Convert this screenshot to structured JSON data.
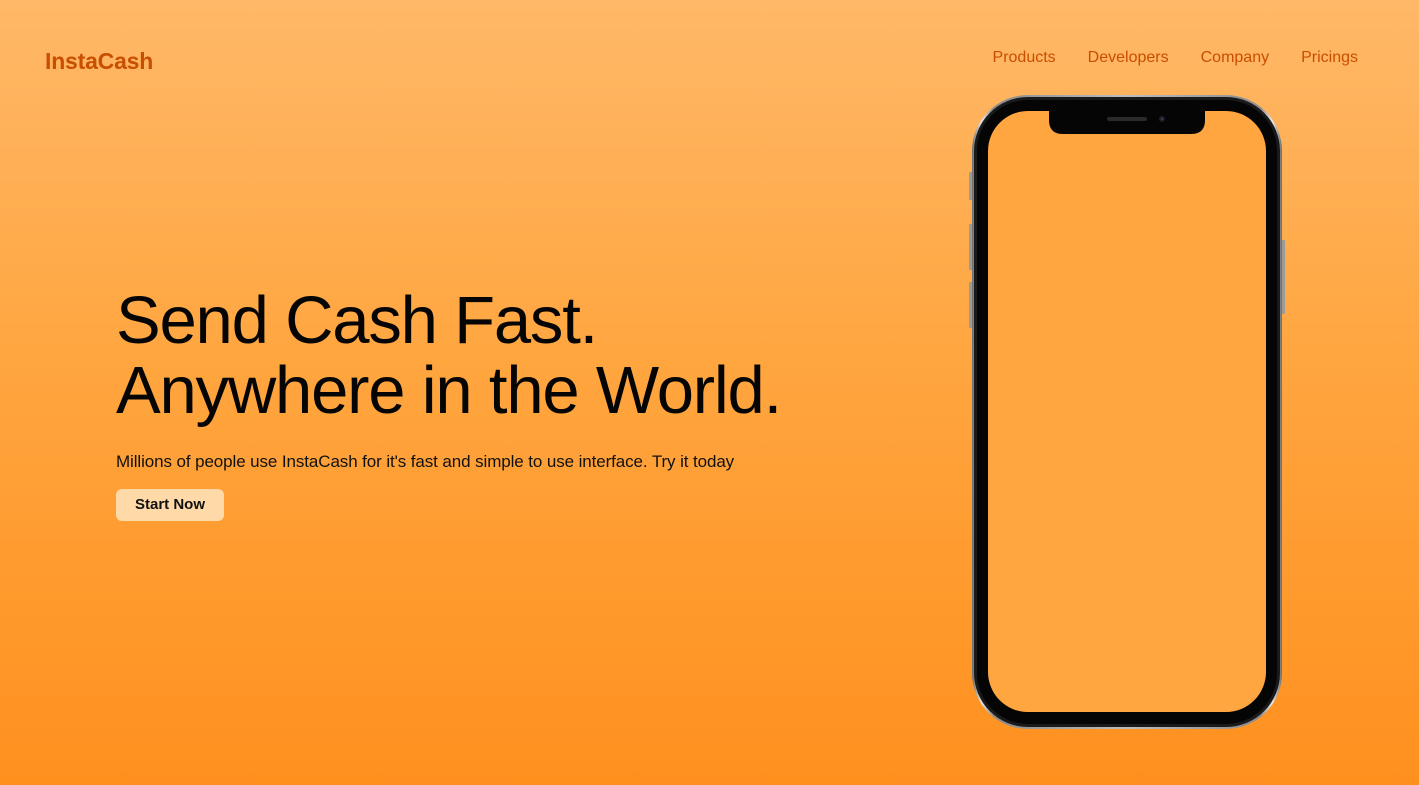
{
  "brand": {
    "name": "InstaCash"
  },
  "nav": {
    "items": [
      {
        "label": "Products"
      },
      {
        "label": "Developers"
      },
      {
        "label": "Company"
      },
      {
        "label": "Pricings"
      }
    ]
  },
  "hero": {
    "headline_line1": "Send Cash Fast.",
    "headline_line2": "Anywhere in the World.",
    "subtext": "Millions of people use InstaCash for it's fast and simple to use interface. Try it today",
    "cta_label": "Start Now"
  },
  "colors": {
    "brand": "#c84f00",
    "background_top": "#ffb868",
    "background_bottom": "#ff901e",
    "button_bg": "#ffd9a8"
  },
  "icons": {
    "device": "smartphone-mockup"
  }
}
